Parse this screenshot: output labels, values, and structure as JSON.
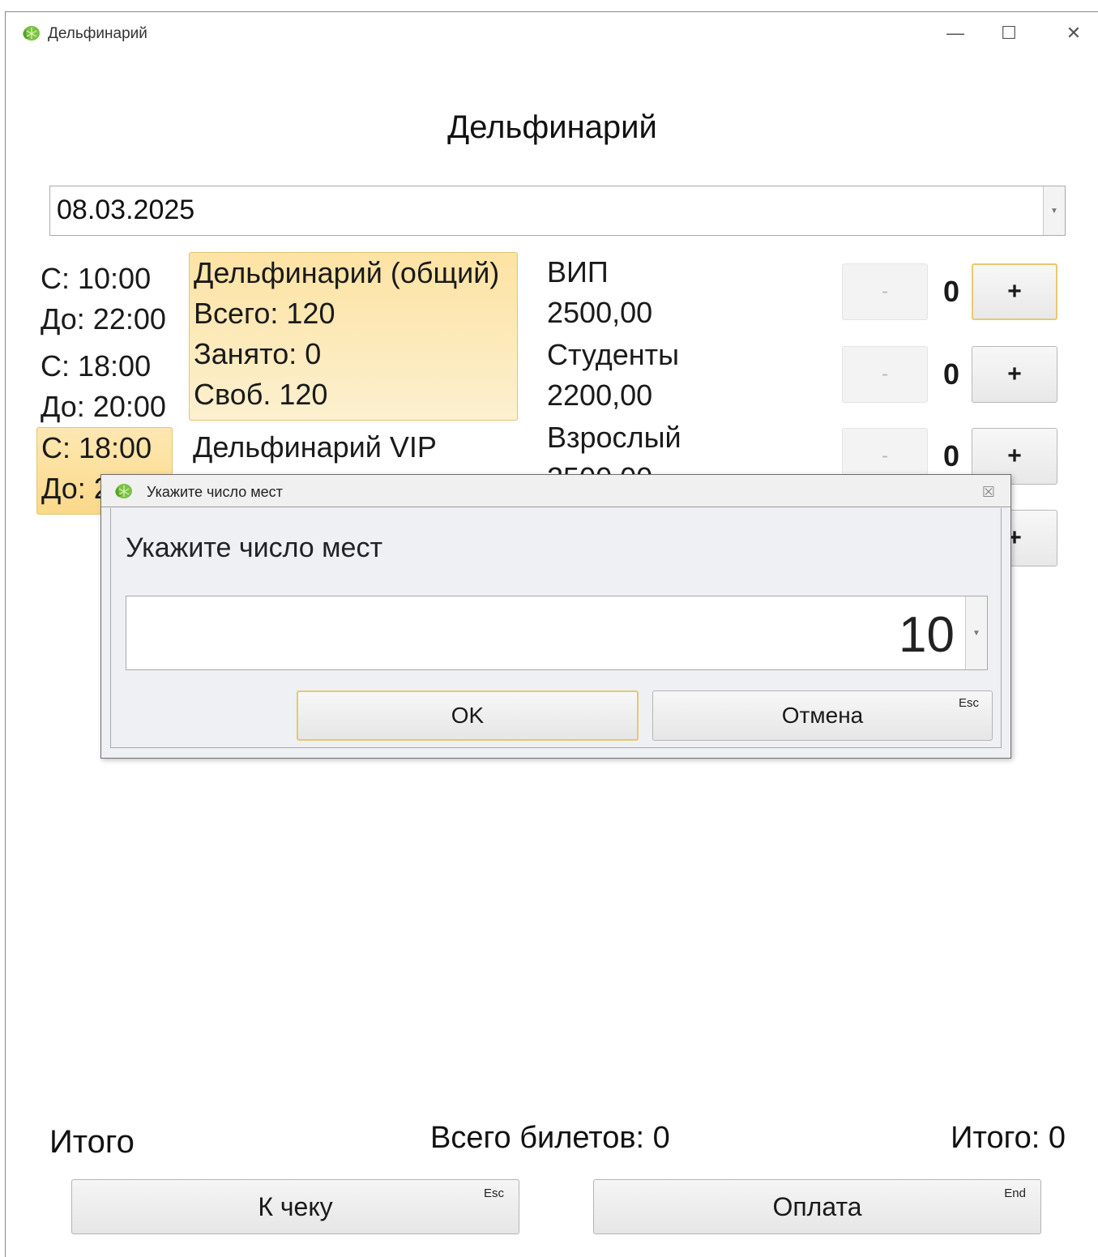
{
  "window": {
    "title": "Дельфинарий",
    "controls": {
      "minimize": "—",
      "maximize": "☐",
      "close": "✕"
    }
  },
  "heading": "Дельфинарий",
  "date_select": {
    "value": "08.03.2025"
  },
  "time_slots": [
    {
      "from": "С: 10:00",
      "to": "До: 22:00",
      "selected": false
    },
    {
      "from": "С: 18:00",
      "to": "До: 20:00",
      "selected": false
    },
    {
      "from": "С: 18:00",
      "to": "До: 2",
      "selected": true
    }
  ],
  "halls": [
    {
      "name": "Дельфинарий (общий)",
      "total": "Всего: 120",
      "occupied": "Занято: 0",
      "free": "Своб. 120",
      "selected": true
    },
    {
      "name": "Дельфинарий VIP"
    }
  ],
  "tickets": [
    {
      "name": "ВИП",
      "price": "2500,00",
      "qty": "0",
      "minus": "-",
      "plus": "+"
    },
    {
      "name": "Студенты",
      "price": "2200,00",
      "qty": "0",
      "minus": "-",
      "plus": "+"
    },
    {
      "name": "Взрослый",
      "price": "2500,00",
      "qty": "0",
      "minus": "-",
      "plus": "+"
    },
    {
      "plus": "+"
    }
  ],
  "summary": {
    "label": "Итого",
    "tickets_total": "Всего билетов: 0",
    "grand_total": "Итого: 0"
  },
  "actions": {
    "receipt": {
      "label": "К чеку",
      "hint": "Esc"
    },
    "pay": {
      "label": "Оплата",
      "hint": "End"
    }
  },
  "dialog": {
    "title": "Укажите число мест",
    "close": "☒",
    "prompt": "Укажите число мест",
    "value": "10",
    "ok": "OK",
    "cancel": {
      "label": "Отмена",
      "hint": "Esc"
    }
  },
  "colors": {
    "accent_border": "#e6c86e",
    "selected_fill": "#fcd989"
  }
}
